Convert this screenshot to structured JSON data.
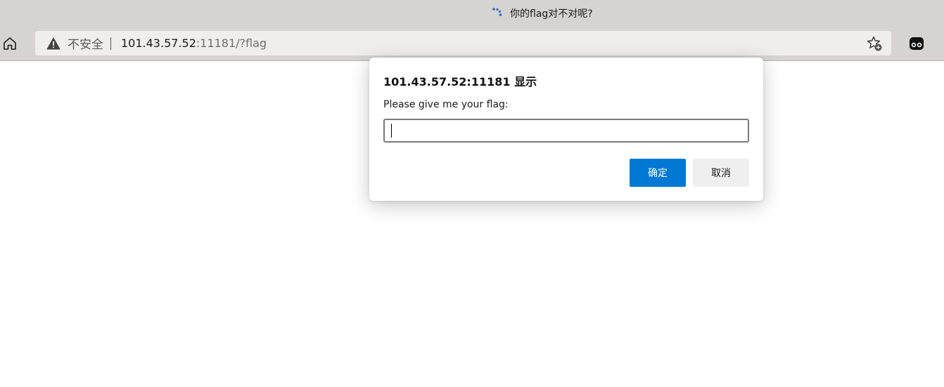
{
  "tab": {
    "title": "你的flag对不对呢?",
    "loading_icon": "loading-spinner-icon",
    "loading_color": "#1a6fc4"
  },
  "toolbar": {
    "home_icon": "home-icon",
    "favorites_icon": "add-favorite-icon",
    "profile_icon": "profile-icon"
  },
  "address_bar": {
    "security_icon": "warning-icon",
    "security_label": "不安全",
    "url_host": "101.43.57.52",
    "url_rest": ":11181/?flag"
  },
  "dialog": {
    "title": "101.43.57.52:11181 显示",
    "message": "Please give me your flag:",
    "input_value": "",
    "ok_label": "确定",
    "cancel_label": "取消",
    "accent_color": "#0078d4"
  }
}
